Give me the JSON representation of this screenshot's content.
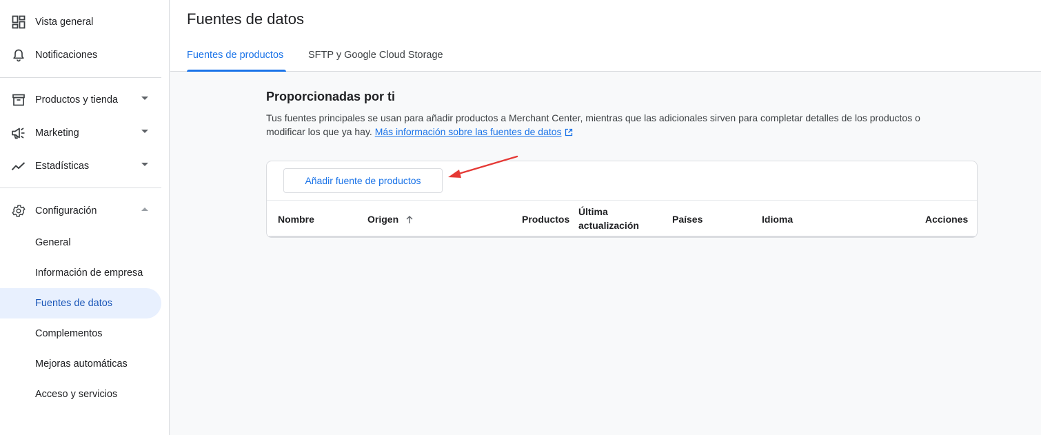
{
  "sidebar": {
    "top_items": [
      {
        "label": "Vista general",
        "icon": "dashboard-icon"
      },
      {
        "label": "Notificaciones",
        "icon": "bell-icon"
      }
    ],
    "group_items": [
      {
        "label": "Productos y tienda",
        "icon": "archive-icon"
      },
      {
        "label": "Marketing",
        "icon": "megaphone-icon"
      },
      {
        "label": "Estadísticas",
        "icon": "trending-icon"
      }
    ],
    "config": {
      "label": "Configuración",
      "icon": "gear-icon"
    },
    "config_items": [
      {
        "label": "General"
      },
      {
        "label": "Información de empresa"
      },
      {
        "label": "Fuentes de datos",
        "active": true
      },
      {
        "label": "Complementos"
      },
      {
        "label": "Mejoras automáticas"
      },
      {
        "label": "Acceso y servicios"
      }
    ]
  },
  "header": {
    "title": "Fuentes de datos",
    "tabs": [
      {
        "label": "Fuentes de productos",
        "active": true
      },
      {
        "label": "SFTP y Google Cloud Storage",
        "active": false
      }
    ]
  },
  "main": {
    "section_title": "Proporcionadas por ti",
    "description": "Tus fuentes principales se usan para añadir productos a Merchant Center, mientras que las adicionales sirven para completar detalles de los productos o modificar los que ya hay.",
    "link_text": "Más información sobre las fuentes de datos",
    "add_button": "Añadir fuente de productos",
    "table_headers": {
      "nombre": "Nombre",
      "origen": "Origen",
      "productos": "Productos",
      "ultima_1": "Última",
      "ultima_2": "actualización",
      "paises": "Países",
      "idioma": "Idioma",
      "acciones": "Acciones"
    }
  },
  "colors": {
    "accent": "#1a73e8",
    "active_bg": "#e8f0fe",
    "annotation_arrow": "#e53935"
  }
}
